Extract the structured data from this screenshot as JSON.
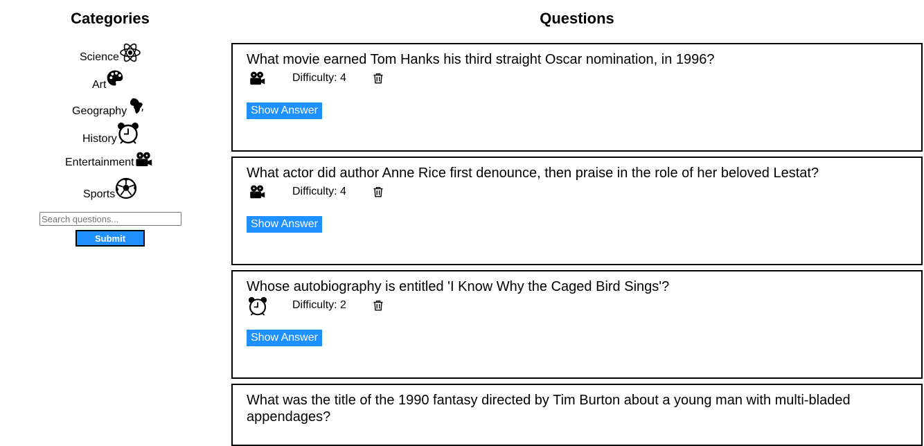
{
  "sidebar": {
    "title": "Categories",
    "categories": [
      {
        "label": "Science",
        "icon": "atom-icon"
      },
      {
        "label": "Art",
        "icon": "palette-icon"
      },
      {
        "label": "Geography",
        "icon": "africa-icon"
      },
      {
        "label": "History",
        "icon": "alarm-clock-icon"
      },
      {
        "label": "Entertainment",
        "icon": "film-projector-icon"
      },
      {
        "label": "Sports",
        "icon": "soccer-ball-icon"
      }
    ],
    "search": {
      "placeholder": "Search questions...",
      "value": ""
    },
    "submit_label": "Submit"
  },
  "main": {
    "title": "Questions",
    "questions": [
      {
        "text": "What movie earned Tom Hanks his third straight Oscar nomination, in 1996?",
        "category_icon": "film-projector-icon",
        "difficulty": "Difficulty: 4",
        "show_answer_label": "Show Answer"
      },
      {
        "text": "What actor did author Anne Rice first denounce, then praise in the role of her beloved Lestat?",
        "category_icon": "film-projector-icon",
        "difficulty": "Difficulty: 4",
        "show_answer_label": "Show Answer"
      },
      {
        "text": "Whose autobiography is entitled 'I Know Why the Caged Bird Sings'?",
        "category_icon": "alarm-clock-icon",
        "difficulty": "Difficulty: 2",
        "show_answer_label": "Show Answer"
      },
      {
        "text": "What was the title of the 1990 fantasy directed by Tim Burton about a young man with multi-bladed appendages?",
        "category_icon": "film-projector-icon",
        "difficulty": "",
        "show_answer_label": ""
      }
    ]
  },
  "colors": {
    "button_blue": "#1e90ff",
    "border": "#000000"
  }
}
